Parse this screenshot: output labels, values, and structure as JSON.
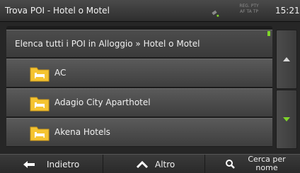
{
  "header": {
    "title": "Trova POI - Hotel o Motel",
    "tmc_status": [
      "REG. PTY",
      "AF TA TP"
    ],
    "clock": "15:21"
  },
  "list": {
    "heading": "Elenca tutti i POI in Alloggio » Hotel o Motel",
    "items": [
      {
        "label": "AC",
        "icon": "hotel-folder-icon"
      },
      {
        "label": "Adagio City Aparthotel",
        "icon": "hotel-folder-icon"
      },
      {
        "label": "Akena Hotels",
        "icon": "hotel-folder-icon"
      }
    ]
  },
  "scroll": {
    "up_icon": "triangle-up-icon",
    "down_icon": "triangle-down-icon",
    "down_color": "#7fd52a"
  },
  "bottom": {
    "back_label": "Indietro",
    "more_label": "Altro",
    "search_label": "Cerca per nome"
  },
  "colors": {
    "accent": "#7fd52a",
    "folder": "#f5c431"
  }
}
